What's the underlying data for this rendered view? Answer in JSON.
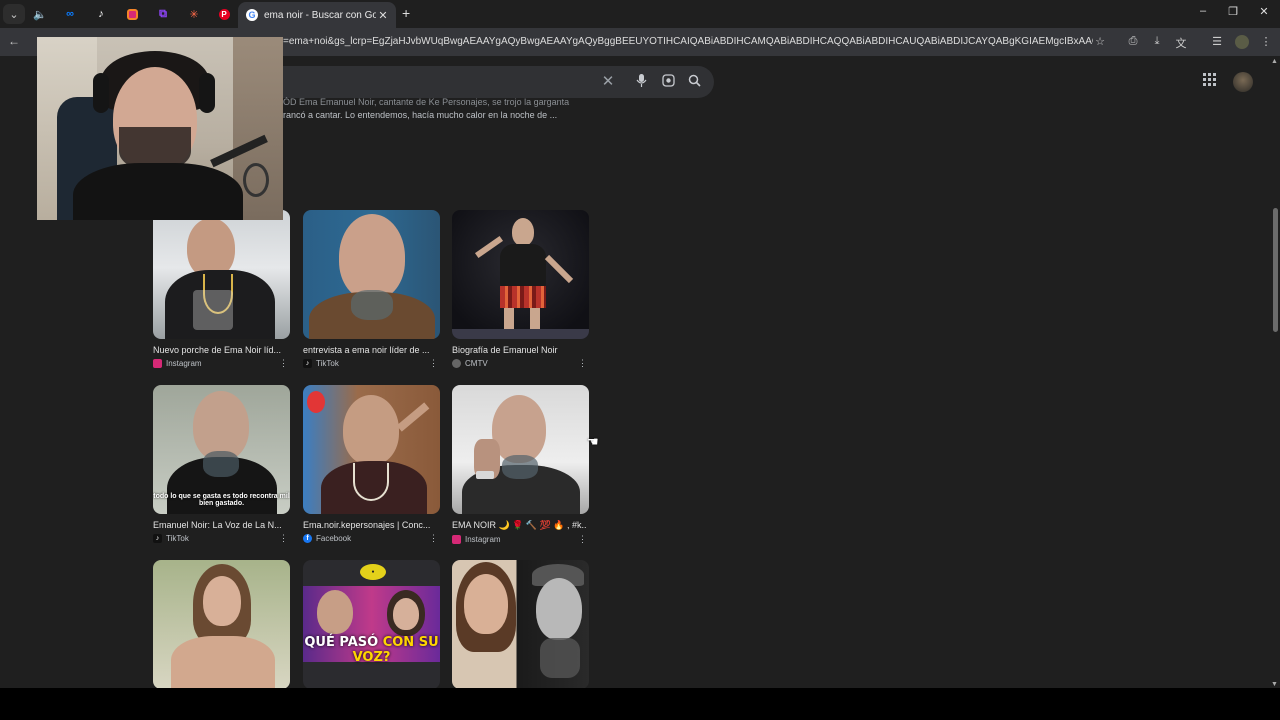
{
  "browser": {
    "active_tab_title": "ema noir - Buscar con Google",
    "new_tab_label": "+",
    "tab_close_label": "✕",
    "url": "=ema+noi&gs_lcrp=EgZjaHJvbWUqBwgAEAAYgAQyBwgAEAAYgAQyBggBEEUYOTIHCAIQABiABDIHCAMQABiABDIHCAQQABiABDIHCAUQABiABDIJCAYQABgKGIAEMgcIBxAAGIAEMgcICBAAGIAE...",
    "pinned_tab_icons": [
      "dropdown-icon",
      "speaker-icon",
      "meta-icon",
      "tiktok-icon",
      "instagram-icon",
      "twitch-icon",
      "asterisk-icon",
      "pinterest-icon"
    ],
    "window_controls": [
      "minimize",
      "restore",
      "close"
    ]
  },
  "search": {
    "clear_symbol": "✕",
    "mic_symbol": "🎙",
    "lens_symbol": "⌗",
    "search_symbol": "⚲"
  },
  "snippet": {
    "line_top": "ÓD Ema Emanuel Noir, cantante de Ke Personajes, se trojo la garganta",
    "line_bottom": "rancó a cantar. Lo entendemos, hacía mucho calor en la noche de ..."
  },
  "images": [
    {
      "caption": "Nuevo porche de Ema Noir líd...",
      "source": "Instagram",
      "favicon_color": "#d62976"
    },
    {
      "caption": "entrevista a ema noir líder de ...",
      "source": "TikTok",
      "favicon_color": "#111111"
    },
    {
      "caption": "Biografía de Emanuel Noir",
      "source": "CMTV",
      "favicon_color": "#666666"
    },
    {
      "caption": "Emanuel Noir: La Voz de La N...",
      "source": "TikTok",
      "favicon_color": "#111111",
      "overlay": "todo lo que se gasta es todo recontra mil bien gastado."
    },
    {
      "caption": "Ema.noir.kepersonajes | Conc...",
      "source": "Facebook",
      "favicon_color": "#1877f2"
    },
    {
      "caption": "EMA NOIR 🌙 🌹 🔨 💯 🔥 , #k...",
      "source": "Instagram",
      "favicon_color": "#d62976"
    },
    {
      "caption": "",
      "source": "",
      "favicon_color": ""
    },
    {
      "caption": "",
      "source": "",
      "favicon_color": "",
      "overlay_white": "QUÉ PASÓ ",
      "overlay_yellow": "CON SU VOZ?"
    },
    {
      "caption": "",
      "source": "",
      "favicon_color": ""
    }
  ],
  "more_symbol": "⋮",
  "colors": {
    "page_bg": "#1f1f1f",
    "tab_bg": "#1f1f1f",
    "address_bg": "#35363a",
    "searchbox_bg": "#303134",
    "caption_accent": "#ffd600"
  }
}
